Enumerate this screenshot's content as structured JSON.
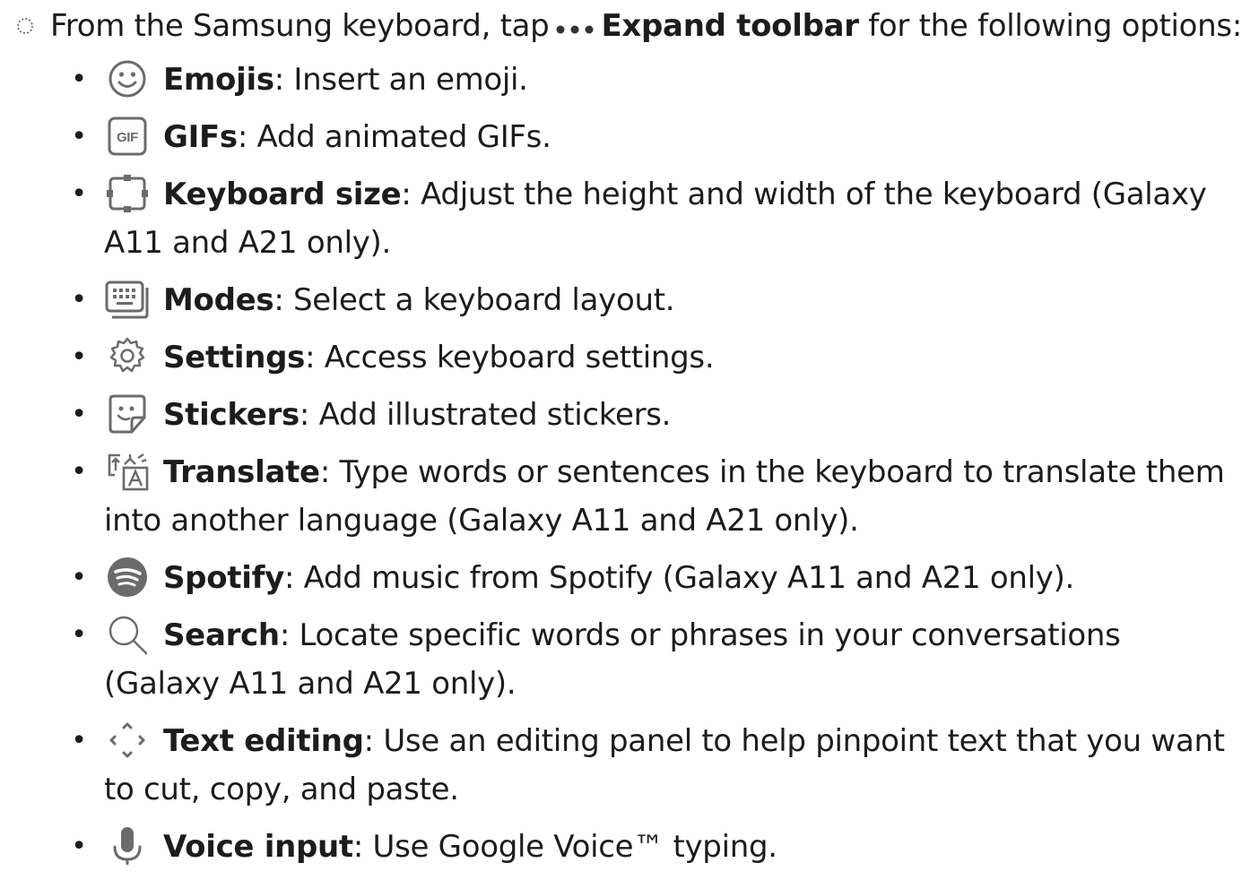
{
  "intro": {
    "prefix": "From the Samsung keyboard, tap",
    "action": "Expand toolbar",
    "suffix": "for the following options:"
  },
  "items": [
    {
      "icon": "emoji-icon",
      "label": "Emojis",
      "desc": ": Insert an emoji."
    },
    {
      "icon": "gif-icon",
      "label": "GIFs",
      "desc": ": Add animated GIFs."
    },
    {
      "icon": "keyboard-size-icon",
      "label": "Keyboard size",
      "desc": ": Adjust the height and width of the keyboard (Galaxy A11 and A21 only)."
    },
    {
      "icon": "modes-icon",
      "label": "Modes",
      "desc": ": Select a keyboard layout."
    },
    {
      "icon": "settings-icon",
      "label": "Settings",
      "desc": ": Access keyboard settings."
    },
    {
      "icon": "stickers-icon",
      "label": "Stickers",
      "desc": ": Add illustrated stickers."
    },
    {
      "icon": "translate-icon",
      "label": "Translate",
      "desc": ": Type words or sentences in the keyboard to translate them into another language (Galaxy A11 and A21 only)."
    },
    {
      "icon": "spotify-icon",
      "label": "Spotify",
      "desc": ": Add music from Spotify (Galaxy A11 and A21 only)."
    },
    {
      "icon": "search-icon",
      "label": "Search",
      "desc": ": Locate specific words or phrases in your conversations (Galaxy A11 and A21 only)."
    },
    {
      "icon": "text-editing-icon",
      "label": "Text editing",
      "desc": ": Use an editing panel to help pinpoint text that you want to cut, copy, and paste."
    },
    {
      "icon": "microphone-icon",
      "label": "Voice input",
      "desc": ": Use Google Voice™ typing."
    }
  ],
  "bullet_char": "•",
  "colors": {
    "text": "#1c1c1c",
    "icon": "#6b6b6b"
  }
}
